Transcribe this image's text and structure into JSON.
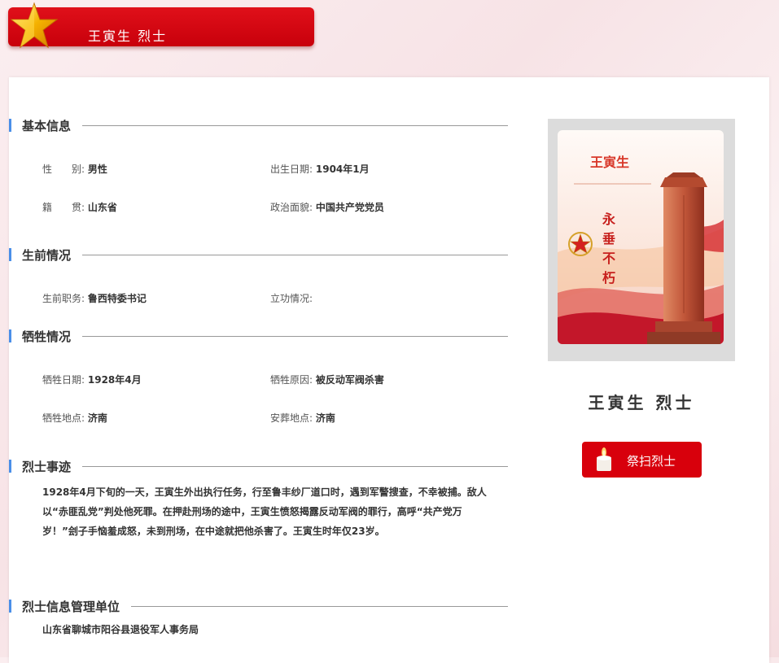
{
  "header": {
    "title": "王寅生 烈士"
  },
  "sections": {
    "basic": {
      "title": "基本信息",
      "gender": {
        "label": "性　　别:",
        "value": "男性"
      },
      "birth": {
        "label": "出生日期:",
        "value": "1904年1月"
      },
      "origin": {
        "label": "籍　　贯:",
        "value": "山东省"
      },
      "political": {
        "label": "政治面貌:",
        "value": "中国共产党党员"
      }
    },
    "life": {
      "title": "生前情况",
      "position": {
        "label": "生前职务:",
        "value": "鲁西特委书记"
      },
      "merit": {
        "label": "立功情况:",
        "value": ""
      }
    },
    "sacrifice": {
      "title": "牺牲情况",
      "date": {
        "label": "牺牲日期:",
        "value": "1928年4月"
      },
      "cause": {
        "label": "牺牲原因:",
        "value": "被反动军阀杀害"
      },
      "place": {
        "label": "牺牲地点:",
        "value": "济南"
      },
      "burial": {
        "label": "安葬地点:",
        "value": "济南"
      }
    },
    "deeds": {
      "title": "烈士事迹",
      "text": "1928年4月下旬的一天，王寅生外出执行任务，行至鲁丰纱厂道口时，遇到军警搜查，不幸被捕。敌人以“赤匪乱党”判处他死罪。在押赴刑场的途中，王寅生愤怒揭露反动军阀的罪行，高呼“共产党万岁！”刽子手恼羞成怒，未到刑场，在中途就把他杀害了。王寅生时年仅23岁。"
    },
    "unit": {
      "title": "烈士信息管理单位",
      "value": "山东省聊城市阳谷县退役军人事务局"
    }
  },
  "portrait": {
    "name": "王寅生",
    "slogan": [
      "永",
      "垂",
      "不",
      "朽"
    ]
  },
  "side": {
    "name_label": "王寅生 烈士",
    "tribute_button": "祭扫烈士"
  },
  "icons": {
    "header": "star-icon",
    "button": "candle-icon"
  },
  "colors": {
    "accent_red": "#d8000c",
    "section_bar": "#4a8fe8"
  }
}
